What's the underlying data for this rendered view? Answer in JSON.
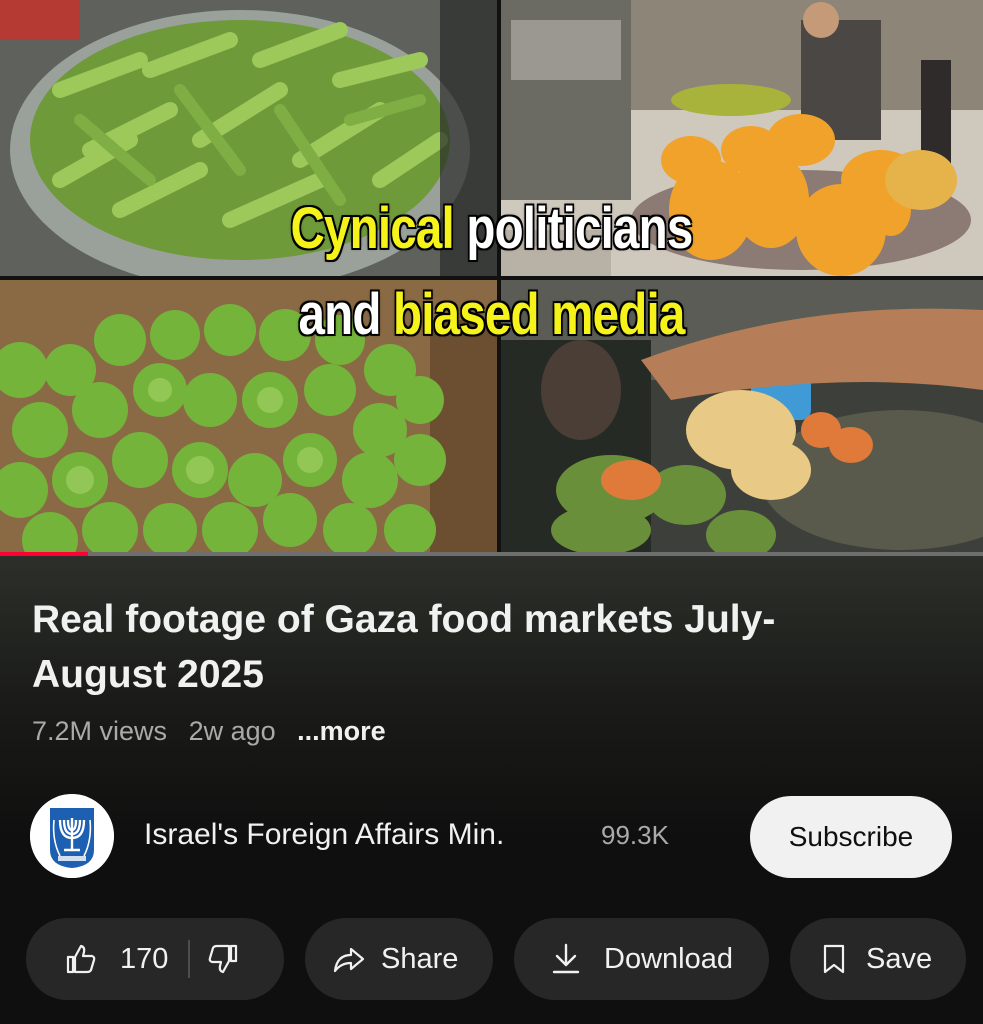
{
  "video": {
    "overlay_line1_a": "Cynical",
    "overlay_line1_b": "politicians",
    "overlay_line2_a": "and",
    "overlay_line2_b": "biased media",
    "progress": 0.09
  },
  "title": "Real footage of Gaza food markets July-August 2025",
  "meta": {
    "views": "7.2M views",
    "age": "2w ago",
    "more": "...more"
  },
  "channel": {
    "name": "Israel's Foreign Affairs Min.",
    "subscribers": "99.3K",
    "subscribe_label": "Subscribe"
  },
  "actions": {
    "likes": "170",
    "share_label": "Share",
    "download_label": "Download",
    "save_label": "Save"
  },
  "colors": {
    "overlay_yellow": "#f5f31a",
    "progress_red": "#ff0033",
    "pill_bg": "#272727",
    "subscribe_bg": "#f1f1f1"
  },
  "icons": [
    "thumb-up-icon",
    "thumb-down-icon",
    "share-arrow-icon",
    "download-icon",
    "bookmark-icon",
    "menorah-emblem"
  ]
}
